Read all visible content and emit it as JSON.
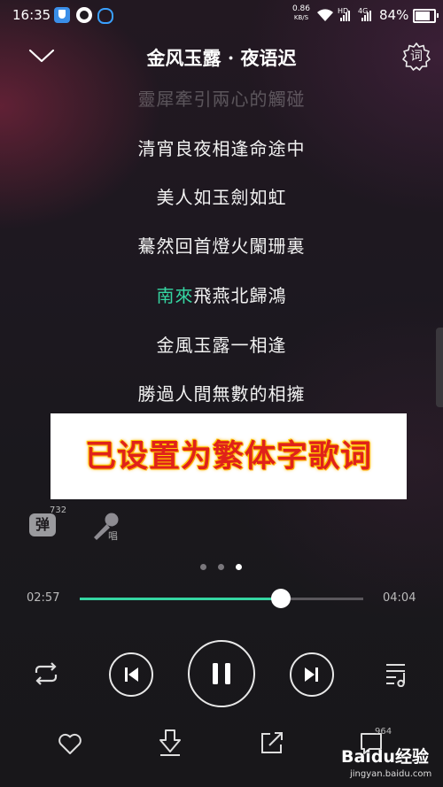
{
  "status_bar": {
    "time": "16:35",
    "net_speed": "0.86",
    "net_unit": "KB/S",
    "sim1_label": "HD",
    "sim2_label": "4G",
    "battery": "84%"
  },
  "header": {
    "title": "金风玉露 · 夜语迟",
    "lyric_button": "词"
  },
  "lyrics": [
    {
      "text": "靈犀牽引兩心的觸碰",
      "faded": true
    },
    {
      "text": "清宵良夜相逢命途中"
    },
    {
      "text": "美人如玉劍如虹"
    },
    {
      "text": "驀然回首燈火闌珊裏"
    },
    {
      "highlight": "南來",
      "rest": "飛燕北歸鴻"
    },
    {
      "text": "金風玉露一相逢"
    },
    {
      "text": "勝過人間無數的相擁"
    }
  ],
  "banner": {
    "text": "已设置为繁体字歌词"
  },
  "tools": {
    "danmu_label": "弹",
    "danmu_count": "732",
    "sing_label": "唱"
  },
  "player": {
    "current_time": "02:57",
    "total_time": "04:04",
    "progress": 0.709,
    "page_count": 3,
    "active_page": 3
  },
  "bottom": {
    "comment_count": "964"
  },
  "watermark": {
    "brand": "Baidu经验",
    "url": "jingyan.baidu.com"
  },
  "colors": {
    "accent": "#35d6a2",
    "banner_text": "#e0221a"
  },
  "icons": [
    "back-chevron-icon",
    "lyric-icon",
    "danmu-icon",
    "microphone-icon",
    "repeat-icon",
    "previous-icon",
    "pause-icon",
    "next-icon",
    "playlist-icon",
    "heart-icon",
    "download-icon",
    "share-icon",
    "comment-icon"
  ]
}
